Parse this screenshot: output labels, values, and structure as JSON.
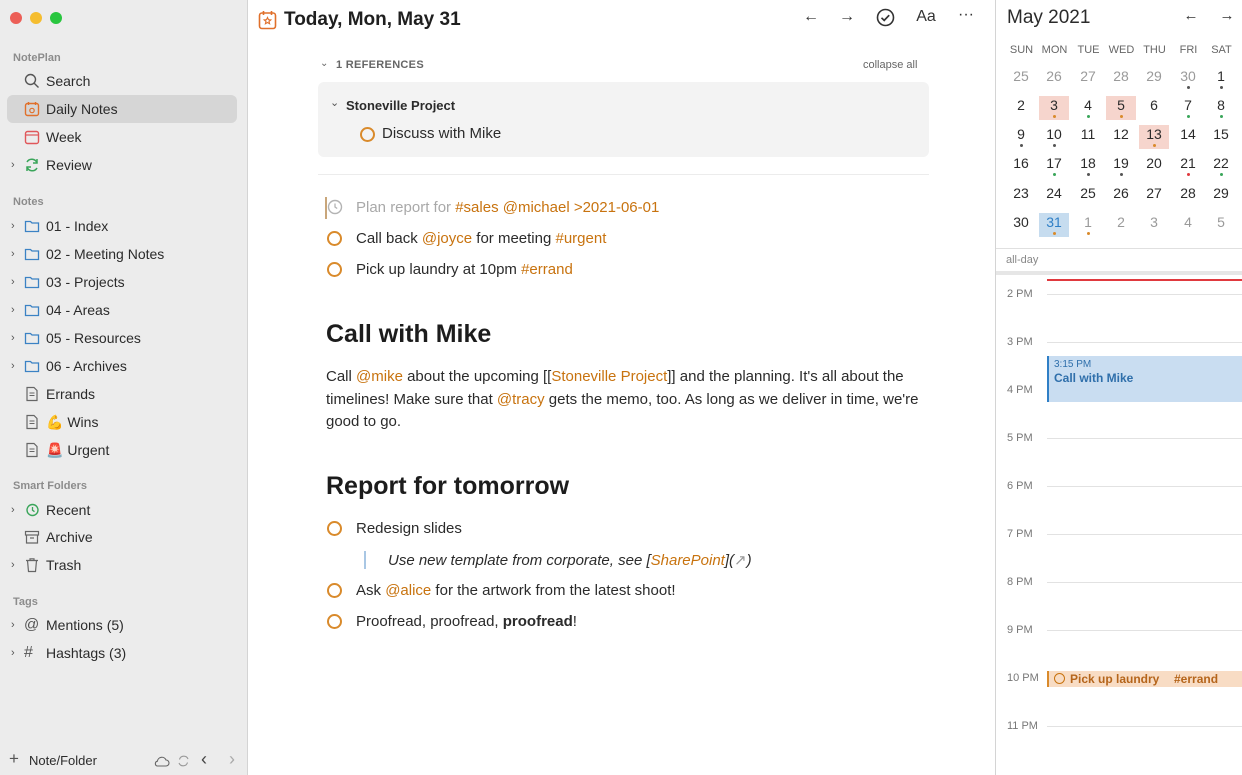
{
  "sidebar": {
    "section_noteplan": "NotePlan",
    "search": "Search",
    "daily_notes": "Daily Notes",
    "week": "Week",
    "review": "Review",
    "section_notes": "Notes",
    "folders": [
      "01 - Index",
      "02 - Meeting Notes",
      "03 - Projects",
      "04 - Areas",
      "05 - Resources",
      "06 - Archives"
    ],
    "errands": "Errands",
    "wins": "Wins",
    "wins_emoji": "💪",
    "urgent": "Urgent",
    "urgent_emoji": "🚨",
    "section_smart": "Smart Folders",
    "recent": "Recent",
    "archive": "Archive",
    "trash": "Trash",
    "section_tags": "Tags",
    "mentions": "Mentions (5)",
    "hashtags": "Hashtags (3)",
    "footer_new": "Note/Folder"
  },
  "header": {
    "title": "Today, Mon, May 31",
    "font_button": "Aa",
    "more_button": "···"
  },
  "references": {
    "count_label": "1 REFERENCES",
    "collapse_all": "collapse all",
    "project": "Stoneville Project",
    "task": "Discuss with Mike"
  },
  "tasks_top": [
    {
      "pre": "Plan report for ",
      "tags": "#sales @michael >2021-06-01",
      "scheduled": true
    },
    {
      "pre": "Call back ",
      "t1": "@joyce",
      "mid": " for meeting ",
      "t2": "#urgent"
    },
    {
      "pre": "Pick up laundry at 10pm ",
      "t1": "#errand"
    }
  ],
  "section1": {
    "heading": "Call with Mike",
    "p_call": "Call ",
    "p_mike": "@mike",
    "p_about": " about the upcoming [[",
    "p_project": "Stoneville Project",
    "p_rest": "]] and the planning. It's all about the timelines! Make sure that ",
    "p_tracy": "@tracy",
    "p_end": " gets the memo, too. As long as we deliver in time, we're good to go."
  },
  "section2": {
    "heading": "Report for tomorrow",
    "task1": "Redesign slides",
    "quote_pre": "Use new template from corporate, see [",
    "quote_link": "SharePoint",
    "quote_post": "](",
    "quote_end": ")",
    "task2_pre": "Ask ",
    "task2_tag": "@alice",
    "task2_post": " for the artwork from the latest shoot!",
    "task3_pre": "Proofread, proofread, ",
    "task3_bold": "proofread",
    "task3_post": "!"
  },
  "calendar": {
    "month": "May 2021",
    "dows": [
      "SUN",
      "MON",
      "TUE",
      "WED",
      "THU",
      "FRI",
      "SAT"
    ],
    "weeks": [
      [
        "25",
        "26",
        "27",
        "28",
        "29",
        "30",
        "1"
      ],
      [
        "2",
        "3",
        "4",
        "5",
        "6",
        "7",
        "8"
      ],
      [
        "9",
        "10",
        "11",
        "12",
        "13",
        "14",
        "15"
      ],
      [
        "16",
        "17",
        "18",
        "19",
        "20",
        "21",
        "22"
      ],
      [
        "23",
        "24",
        "25",
        "26",
        "27",
        "28",
        "29"
      ],
      [
        "30",
        "31",
        "1",
        "2",
        "3",
        "4",
        "5"
      ]
    ],
    "all_day": "all-day",
    "hours": [
      "2 PM",
      "3 PM",
      "4 PM",
      "5 PM",
      "6 PM",
      "7 PM",
      "8 PM",
      "9 PM",
      "10 PM",
      "11 PM"
    ],
    "event1_time": "3:15 PM",
    "event1_title": "Call with Mike",
    "event2_title": "Pick up laundry",
    "event2_tag": "#errand",
    "accent_blue": "#2f7fc6",
    "accent_orange": "#d98a2b"
  }
}
